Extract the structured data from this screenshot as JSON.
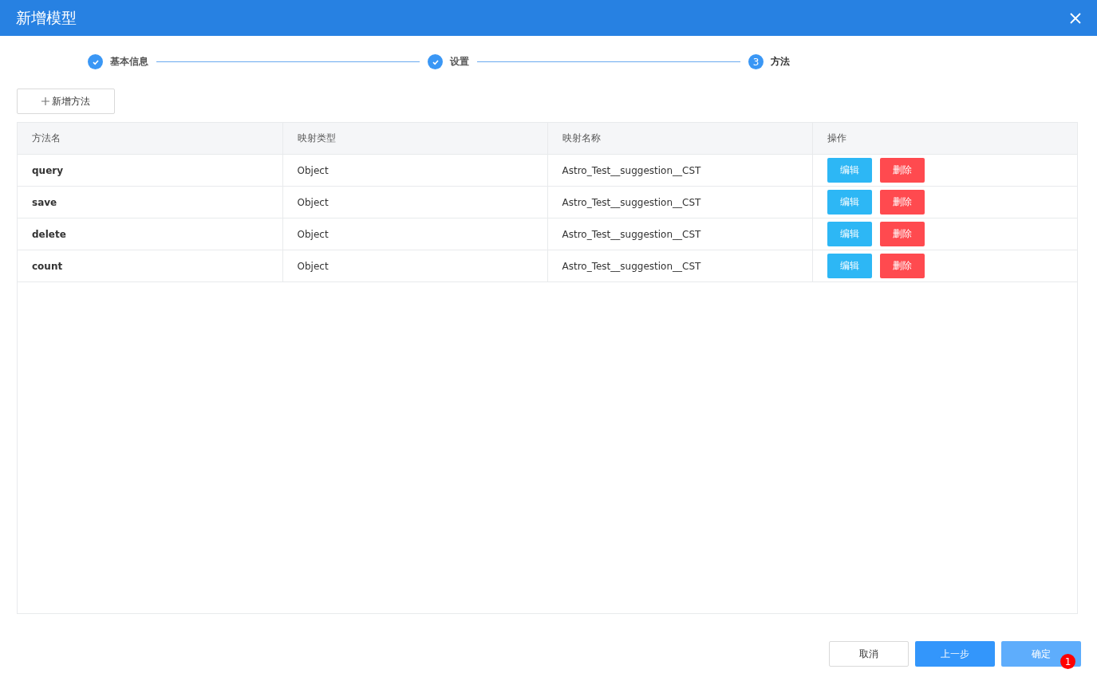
{
  "dialog": {
    "title": "新增模型"
  },
  "steps": [
    {
      "label": "基本信息",
      "done": true
    },
    {
      "label": "设置",
      "done": true
    },
    {
      "label": "方法",
      "number": "3",
      "done": false
    }
  ],
  "add_button": {
    "label": "新增方法"
  },
  "table": {
    "columns": [
      "方法名",
      "映射类型",
      "映射名称",
      "操作"
    ],
    "rows": [
      {
        "name": "query",
        "type": "Object",
        "mapping": "Astro_Test__suggestion__CST",
        "actions": [
          "编辑",
          "删除"
        ]
      },
      {
        "name": "save",
        "type": "Object",
        "mapping": "Astro_Test__suggestion__CST",
        "actions": [
          "编辑",
          "删除"
        ]
      },
      {
        "name": "delete",
        "type": "Object",
        "mapping": "Astro_Test__suggestion__CST",
        "actions": [
          "编辑",
          "删除"
        ]
      },
      {
        "name": "count",
        "type": "Object",
        "mapping": "Astro_Test__suggestion__CST",
        "actions": [
          "编辑",
          "删除"
        ]
      }
    ]
  },
  "footer": {
    "buttons": [
      {
        "label": "取消",
        "kind": "plain",
        "disabled": false
      },
      {
        "label": "上一步",
        "kind": "primary",
        "disabled": false
      },
      {
        "label": "确定",
        "kind": "primary",
        "disabled": true
      }
    ],
    "badge": "1"
  }
}
